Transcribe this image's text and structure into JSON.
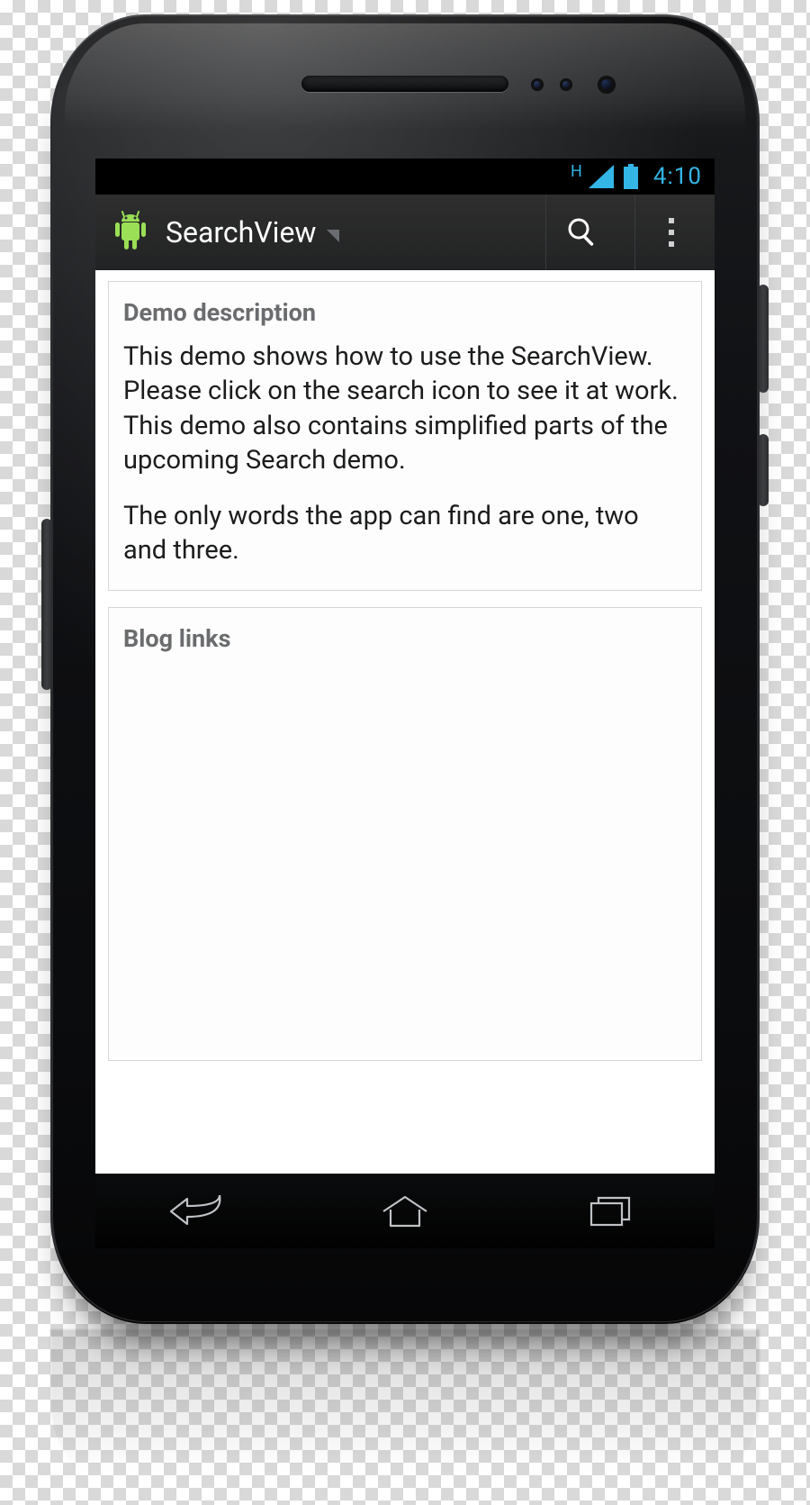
{
  "status": {
    "network_label": "H",
    "time": "4:10"
  },
  "actionbar": {
    "title": "SearchView"
  },
  "content": {
    "card1": {
      "heading": "Demo description",
      "p1": "This demo shows how to use the SearchView. Please click on the search icon to see it at work. This demo also contains simplified parts of the upcoming Search demo.",
      "p2": "The only words the app can find are one, two and three."
    },
    "card2": {
      "heading": "Blog links"
    }
  }
}
